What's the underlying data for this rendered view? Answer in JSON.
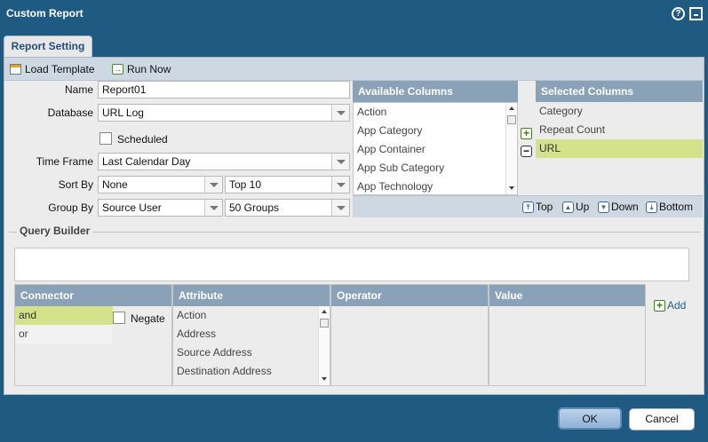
{
  "dialog": {
    "title": "Custom Report",
    "help_icon": "help-circle-icon",
    "minimize_icon": "window-minimize-icon",
    "tab": "Report Setting"
  },
  "toolbar": {
    "load_template": "Load Template",
    "run_now": "Run Now"
  },
  "form": {
    "name_label": "Name",
    "name_value": "Report01",
    "database_label": "Database",
    "database_value": "URL Log",
    "scheduled_label": "Scheduled",
    "scheduled_checked": false,
    "timeframe_label": "Time Frame",
    "timeframe_value": "Last Calendar Day",
    "sortby_label": "Sort By",
    "sortby_value": "None",
    "sortby_top": "Top 10",
    "groupby_label": "Group By",
    "groupby_value": "Source User",
    "groupby_count": "50 Groups"
  },
  "available_columns": {
    "header": "Available Columns",
    "items": [
      "Action",
      "App Category",
      "App Container",
      "App Sub Category",
      "App Technology"
    ]
  },
  "selected_columns": {
    "header": "Selected Columns",
    "items": [
      "Category",
      "Repeat Count",
      "URL"
    ],
    "selected": "URL"
  },
  "move_controls": {
    "top": "Top",
    "up": "Up",
    "down": "Down",
    "bottom": "Bottom"
  },
  "query_builder": {
    "title": "Query Builder",
    "text": "",
    "connector_header": "Connector",
    "connectors": [
      "and",
      "or"
    ],
    "negate_label": "Negate",
    "attribute_header": "Attribute",
    "attributes": [
      "Action",
      "Address",
      "Source Address",
      "Destination Address"
    ],
    "operator_header": "Operator",
    "value_header": "Value",
    "add_label": "Add"
  },
  "footer": {
    "ok": "OK",
    "cancel": "Cancel"
  },
  "colors": {
    "titlebar": "#1f5a82",
    "header": "#8aa2b8",
    "selection": "#d4e28a",
    "toolbar": "#cdd8e2"
  }
}
